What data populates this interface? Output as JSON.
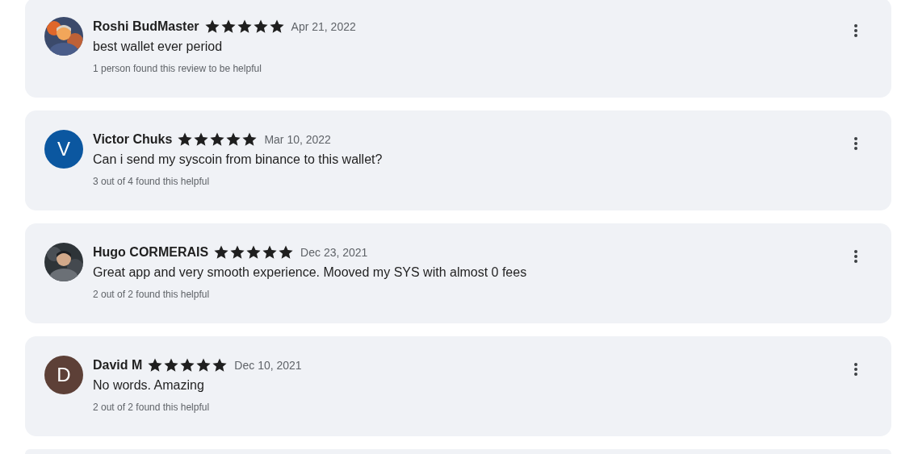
{
  "reviews": [
    {
      "name": "Roshi BudMaster",
      "stars": 5,
      "date": "Apr 21, 2022",
      "text": "best wallet ever period",
      "helpful": "1 person found this review to be helpful"
    },
    {
      "avatar": {
        "kind": "letter",
        "letter": "V",
        "color": "#0b57a0"
      },
      "name": "Victor Chuks",
      "stars": 5,
      "date": "Mar 10, 2022",
      "text": "Can i send my syscoin from binance to this wallet?",
      "helpful": "3 out of 4 found this helpful"
    },
    {
      "name": "Hugo CORMERAIS",
      "stars": 5,
      "date": "Dec 23, 2021",
      "text": "Great app and very smooth experience. Mooved my SYS with almost 0 fees",
      "helpful": "2 out of 2 found this helpful"
    },
    {
      "avatar": {
        "kind": "letter",
        "letter": "D",
        "color": "#5d4037"
      },
      "name": "David M",
      "stars": 5,
      "date": "Dec 10, 2021",
      "text": "No words. Amazing",
      "helpful": "2 out of 2 found this helpful"
    }
  ]
}
